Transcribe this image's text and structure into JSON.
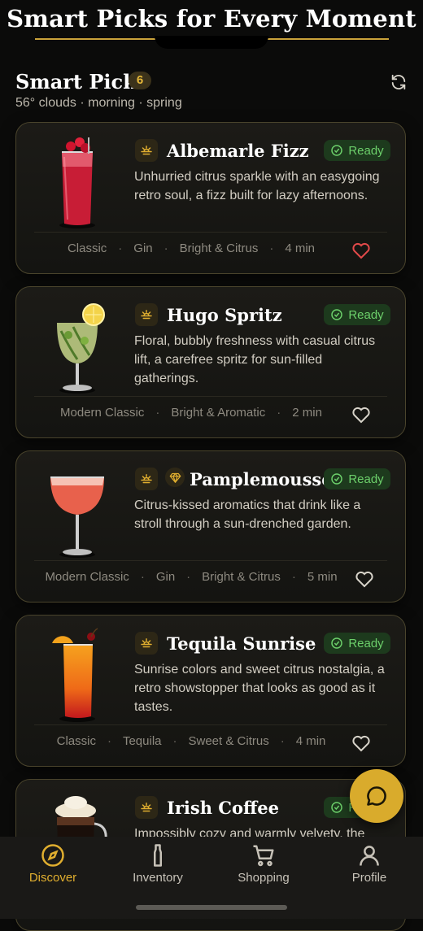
{
  "banner": {
    "title": "Smart Picks for Every Moment"
  },
  "header": {
    "title": "Smart Picks",
    "count": "6",
    "subtitle": "56° clouds · morning · spring",
    "refresh_icon": "refresh-icon"
  },
  "colors": {
    "accent": "#e0ae2f",
    "ready_bg": "#1d3a1d",
    "ready_text": "#6ccf6a",
    "heart_active": "#e24a4a",
    "card_border": "#4a442c"
  },
  "cards": [
    {
      "name": "Albemarle Fizz",
      "status": "Ready",
      "description": "Unhurried citrus sparkle with an easygoing retro soul, a fizz built for lazy afternoons.",
      "tags": [
        "Classic",
        "Gin",
        "Bright & Citrus",
        "4 min"
      ],
      "favorited": true
    },
    {
      "name": "Hugo Spritz",
      "status": "Ready",
      "description": "Floral, bubbly freshness with casual citrus lift, a carefree spritz for sun-filled gatherings.",
      "tags": [
        "Modern Classic",
        "Bright & Aromatic",
        "2 min"
      ],
      "favorited": false
    },
    {
      "name": "Pamplemousse",
      "status": "Ready",
      "description": "Citrus-kissed aromatics that drink like a stroll through a sun-drenched garden.",
      "tags": [
        "Modern Classic",
        "Gin",
        "Bright & Citrus",
        "5 min"
      ],
      "favorited": false
    },
    {
      "name": "Tequila Sunrise",
      "status": "Ready",
      "description": "Sunrise colors and sweet citrus nostalgia, a retro showstopper that looks as good as it tastes.",
      "tags": [
        "Classic",
        "Tequila",
        "Sweet & Citrus",
        "4 min"
      ],
      "favorited": false
    },
    {
      "name": "Irish Coffee",
      "status": "Ready",
      "description": "Impossibly cozy and warmly velvety, the"
    }
  ],
  "tabs": [
    {
      "label": "Discover",
      "icon": "compass-icon",
      "active": true
    },
    {
      "label": "Inventory",
      "icon": "bottle-icon",
      "active": false
    },
    {
      "label": "Shopping",
      "icon": "cart-icon",
      "active": false
    },
    {
      "label": "Profile",
      "icon": "person-icon",
      "active": false
    }
  ]
}
